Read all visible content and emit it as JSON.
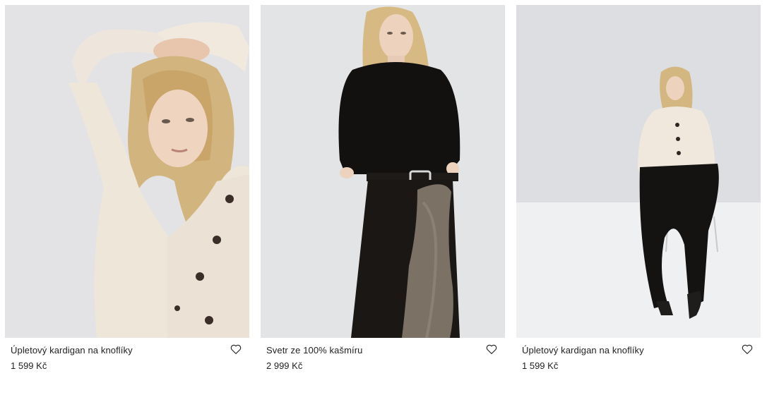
{
  "products": [
    {
      "name": "Úpletový kardigan na knoflíky",
      "price": "1 599 Kč",
      "image_subject": "model-cream-cardigan-closeup",
      "favorite_icon": "heart-outline-icon"
    },
    {
      "name": "Svetr ze 100% kašmíru",
      "price": "2 999 Kč",
      "image_subject": "model-black-cashmere-sweater",
      "favorite_icon": "heart-outline-icon"
    },
    {
      "name": "Úpletový kardigan na knoflíky",
      "price": "1 599 Kč",
      "image_subject": "model-seated-cream-cardigan",
      "favorite_icon": "heart-outline-icon"
    }
  ]
}
